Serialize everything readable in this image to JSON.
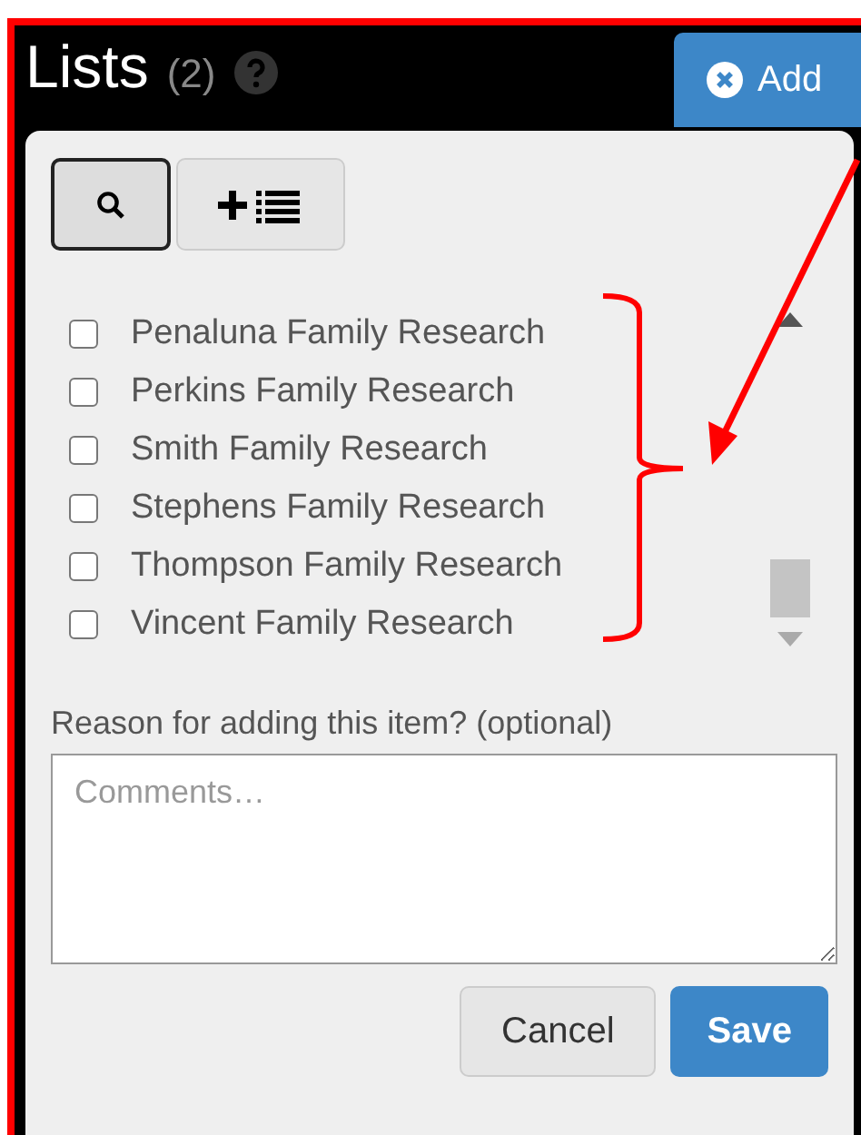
{
  "header": {
    "title": "Lists",
    "count": "(2)"
  },
  "add_button": {
    "label": "Add"
  },
  "tools": [
    {
      "kind": "search",
      "selected": true
    },
    {
      "kind": "new-list",
      "selected": false
    }
  ],
  "lists": [
    {
      "label": "Penaluna Family Research",
      "checked": false
    },
    {
      "label": "Perkins Family Research",
      "checked": false
    },
    {
      "label": "Smith Family Research",
      "checked": false
    },
    {
      "label": "Stephens Family Research",
      "checked": false
    },
    {
      "label": "Thompson Family Research",
      "checked": false
    },
    {
      "label": "Vincent Family Research",
      "checked": false
    }
  ],
  "comment": {
    "label": "Reason for adding this item? (optional)",
    "placeholder": "Comments…"
  },
  "buttons": [
    {
      "label": "Cancel",
      "kind": "default"
    },
    {
      "label": "Save",
      "kind": "primary"
    }
  ]
}
